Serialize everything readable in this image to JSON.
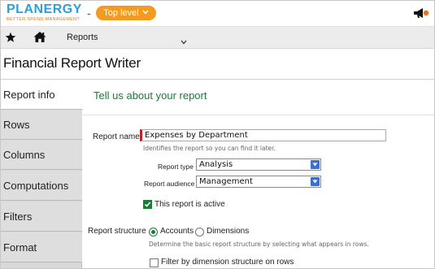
{
  "brand": {
    "name": "PLANERGY",
    "tagline": "BETTER SPEND MANAGEMENT",
    "text_color": "#2a9fd8",
    "tagline_color": "#e8731c"
  },
  "header": {
    "separator": "-",
    "level_button": "Top level",
    "level_icon": "chevron-down-icon",
    "accent": "#f39a1f",
    "announce_icon": "megaphone-icon"
  },
  "nav": {
    "favorites_icon": "star-icon",
    "home_icon": "home-icon",
    "current": "Reports",
    "menu_icon": "chevron-down-icon"
  },
  "page": {
    "title": "Financial Report Writer"
  },
  "sidebar": {
    "items": [
      {
        "label": "Report info",
        "active": true
      },
      {
        "label": "Rows",
        "active": false
      },
      {
        "label": "Columns",
        "active": false
      },
      {
        "label": "Computations",
        "active": false
      },
      {
        "label": "Filters",
        "active": false
      },
      {
        "label": "Format",
        "active": false
      }
    ]
  },
  "form": {
    "section_title": "Tell us about your report",
    "section_color": "#1a7a35",
    "report_name": {
      "label": "Report name",
      "value": "Expenses by Department",
      "help": "Identifies the report so you can find it later."
    },
    "report_type": {
      "label": "Report type",
      "value": "Analysis"
    },
    "report_audience": {
      "label": "Report audience",
      "value": "Management"
    },
    "active": {
      "label": "This report is active",
      "checked": true
    },
    "structure": {
      "label": "Report structure",
      "options": [
        {
          "label": "Accounts",
          "checked": true
        },
        {
          "label": "Dimensions",
          "checked": false
        }
      ],
      "help": "Determine the basic report structure by selecting what appears in rows."
    },
    "filter_dimension": {
      "label": "Filter by dimension structure on rows",
      "checked": false
    }
  }
}
